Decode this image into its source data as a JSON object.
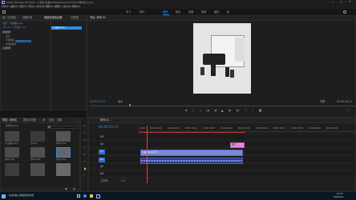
{
  "window": {
    "title": "Adobe Premiere Pro 2020 - C:\\用户\\文档\\Adobe\\Premiere Pro\\14.0\\未命名.prproj"
  },
  "menu": [
    "文件(F)",
    "编辑(E)",
    "剪辑(C)",
    "序列(S)",
    "标记(M)",
    "图形(G)",
    "视图(V)",
    "窗口(W)",
    "帮助(H)"
  ],
  "workspaces": [
    "学习",
    "组件",
    "编辑",
    "颜色",
    "效果",
    "音频",
    "图形",
    "库"
  ],
  "active_workspace": "编辑",
  "source_panel": {
    "tabs": [
      "源: (无剪辑)",
      "效果控件",
      "音频剪辑混合器",
      "元数据"
    ],
    "row_master": "主要 * 产品视频.mp4",
    "row_seq": "序列 01 * 产品视频.mp4",
    "section": "视频效果",
    "items": [
      "运动",
      "不透明度",
      "时间重映射"
    ],
    "audio_section": "音频效果",
    "mini_clip": "产品视频.mp4"
  },
  "program_monitor": {
    "tab": "节目: 序列 01",
    "timecode_left": "00:00:03:15",
    "fit": "适合",
    "resolution": "完整",
    "timecode_right": "00:00:26:01"
  },
  "project_panel": {
    "tabs": [
      "项目: 未命名",
      "媒体浏览器",
      "库",
      "信息",
      "效果"
    ],
    "path": "未命名.prproj",
    "search_placeholder": "",
    "items": [
      {
        "name": "产品视频.mp4",
        "dur": "26:01"
      },
      {
        "name": "序列 01",
        "dur": "26:01"
      },
      {
        "name": "素材2.mp4",
        "dur": "10:12"
      },
      {
        "name": "素材3.mp4",
        "dur": "8:05"
      },
      {
        "name": "素材4.mp4",
        "dur": "5:20"
      },
      {
        "name": "素材5.mp4",
        "dur": "4:18"
      }
    ]
  },
  "timeline": {
    "tab": "序列 01",
    "timecode": "00:00:03:15",
    "ruler": [
      "00:00",
      "00:00:05:00",
      "00:00:10:00",
      "00:00:15:00",
      "00:00:20:00",
      "00:00:25:00",
      "00:00:30:00",
      "00:00:35:00",
      "00:00:40:00",
      "00:00:45:00",
      "00:00:50:00",
      "00:00:55:00"
    ],
    "tracks": [
      "V3",
      "V2",
      "V1",
      "A1",
      "A2",
      "A3"
    ],
    "mix": "主声道",
    "mix_val": "0.0",
    "clip_title": "图形",
    "clip_v1": "产品视频.mp4 [V]"
  },
  "taskbar": {
    "search": "在这里输入你要搜索的内容",
    "time": "10:35",
    "date": "2020/3/14"
  },
  "colors": {
    "accent": "#2d8ceb",
    "playhead": "#ff3333",
    "video_clip": "#7b88d8",
    "audio_clip": "#2c3f86",
    "graphic_clip": "#e08ad8"
  }
}
